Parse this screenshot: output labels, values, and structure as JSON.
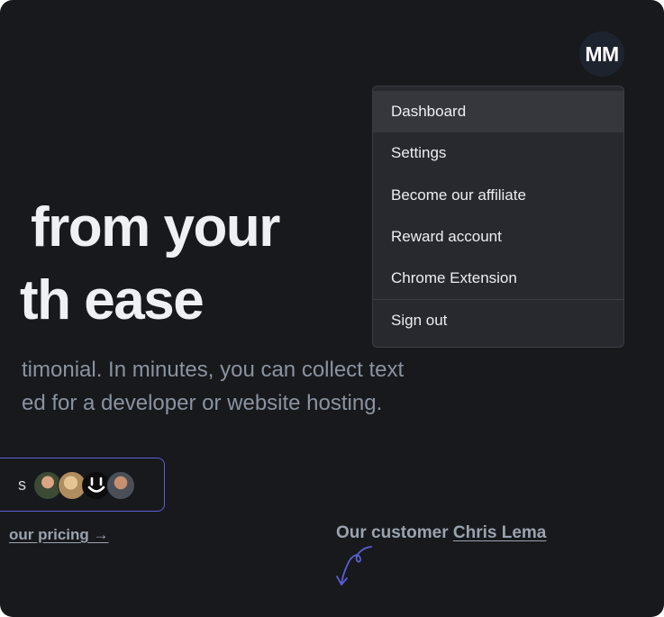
{
  "hero": {
    "line1": "from your",
    "line2": "th ease",
    "sub1": "timonial. In minutes, you can collect text",
    "sub2": "ed for a developer or website hosting."
  },
  "cta": {
    "fragment": "s",
    "avatars": [
      "avatar",
      "avatar",
      "smile-logo-icon",
      "avatar"
    ]
  },
  "pricing_link": "our pricing →",
  "customer": {
    "prefix": "Our customer",
    "name": "Chris Lema"
  },
  "user": {
    "initials": "MM"
  },
  "menu": {
    "items": [
      {
        "label": "Dashboard",
        "active": true
      },
      {
        "label": "Settings"
      },
      {
        "label": "Become our affiliate"
      },
      {
        "label": "Reward account"
      },
      {
        "label": "Chrome Extension"
      },
      {
        "label": "Sign out"
      }
    ]
  },
  "colors": {
    "background": "#18191c",
    "menu_bg": "#27292e",
    "menu_active": "#35373c",
    "accent": "#5b5fd6",
    "hero_text": "#eef0f3",
    "muted_text": "#8a93a0"
  }
}
